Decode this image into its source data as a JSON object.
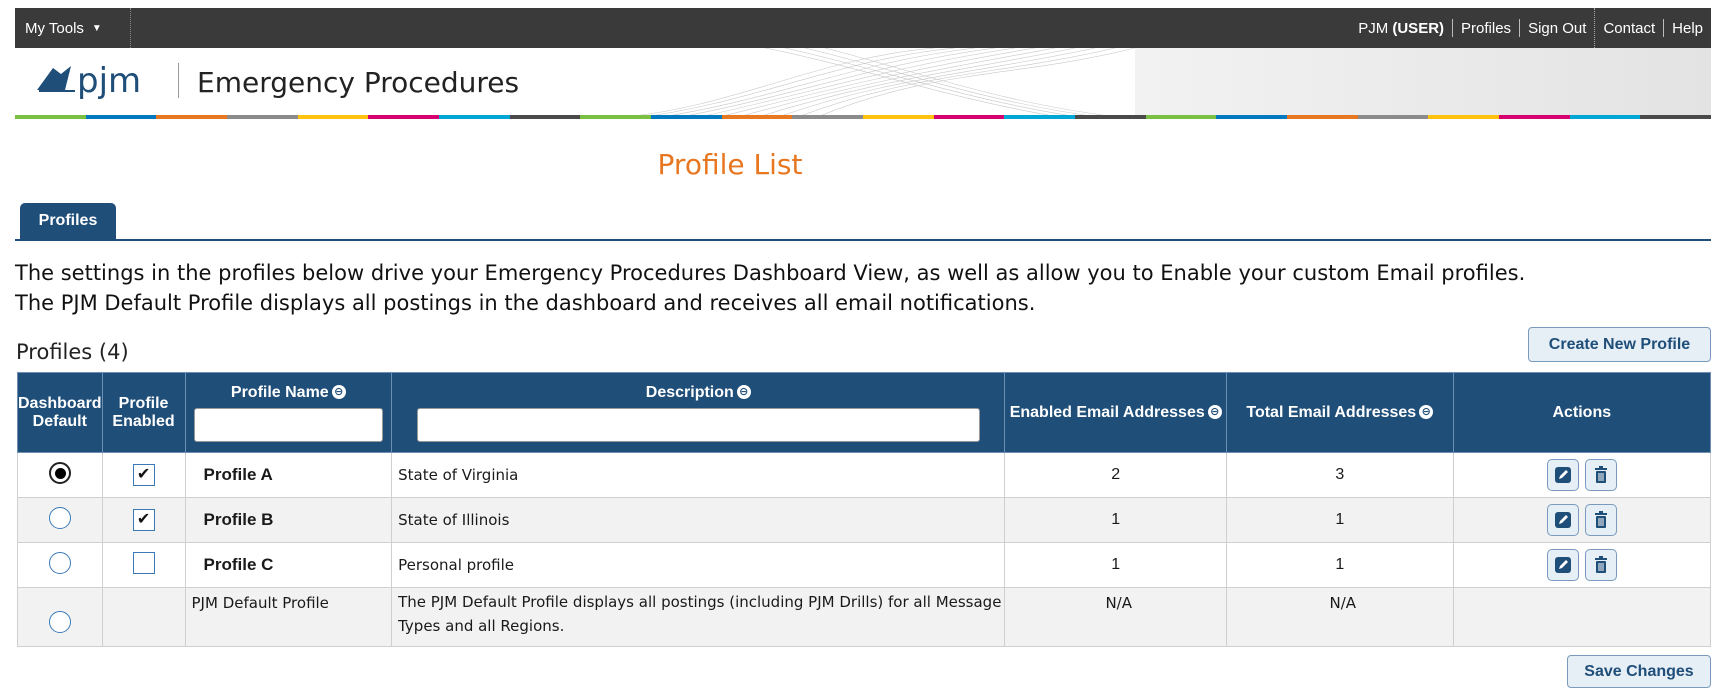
{
  "topbar": {
    "my_tools": "My Tools",
    "user_org": "PJM",
    "user_role": "(USER)",
    "profiles": "Profiles",
    "sign_out": "Sign Out",
    "contact": "Contact",
    "help": "Help"
  },
  "header": {
    "logo_text": "pjm",
    "app_title": "Emergency Procedures",
    "brand_colors": [
      "#7ac143",
      "#0079c1",
      "#e87722",
      "#8b8b8b",
      "#ffc20e",
      "#d6006f",
      "#00a6d6",
      "#4a4a4a"
    ]
  },
  "page": {
    "title": "Profile List",
    "tab": "Profiles",
    "intro_line1": "The settings in the profiles below drive your Emergency Procedures Dashboard View, as well as allow you to Enable your custom Email profiles.",
    "intro_line2": "The PJM Default Profile displays all postings in the dashboard and receives all email notifications.",
    "section_title": "Profiles (4)",
    "create_button": "Create New Profile",
    "save_button": "Save Changes"
  },
  "table": {
    "headers": {
      "dashboard_default": "Dashboard Default",
      "profile_enabled": "Profile Enabled",
      "profile_name": "Profile Name",
      "description": "Description",
      "enabled_email": "Enabled Email Addresses",
      "total_email": "Total Email Addresses",
      "actions": "Actions"
    },
    "rows": [
      {
        "name": "Profile A",
        "description": "State of Virginia",
        "enabled": "2",
        "total": "3",
        "default": true,
        "checked": true
      },
      {
        "name": "Profile B",
        "description": "State of Illinois",
        "enabled": "1",
        "total": "1",
        "default": false,
        "checked": true
      },
      {
        "name": "Profile C",
        "description": "Personal profile",
        "enabled": "1",
        "total": "1",
        "default": false,
        "checked": false
      }
    ],
    "default_row": {
      "name": "PJM Default Profile",
      "description": "The PJM Default Profile displays all postings (including PJM Drills) for all Message Types and all Regions.",
      "enabled": "N/A",
      "total": "N/A"
    },
    "check_mark": "✔"
  }
}
